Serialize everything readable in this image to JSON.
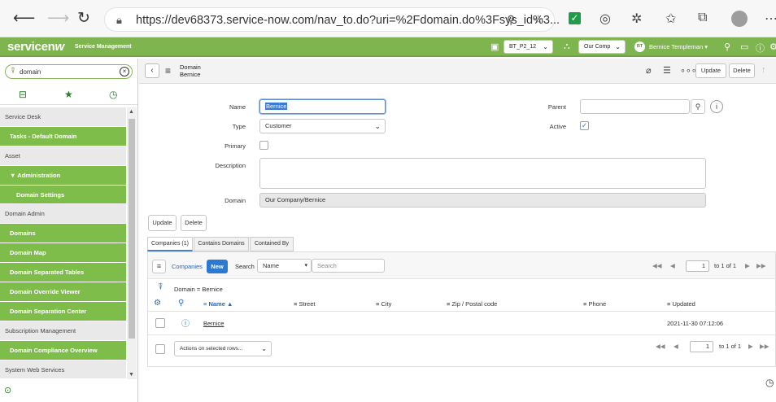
{
  "browser": {
    "url": "https://dev68373.service-now.com/nav_to.do?uri=%2Fdomain.do%3Fsys_id%3..."
  },
  "header": {
    "logo": "servicen",
    "logo_mark": "w",
    "product": "Service Management",
    "update_set": "BT_P2_12",
    "domain_picker": "Our Comp",
    "user_initials": "BT",
    "user_name": "Bernice Templeman"
  },
  "sidebar": {
    "filter_value": "domain",
    "items": [
      {
        "label": "Service Desk",
        "type": "section"
      },
      {
        "label": "Tasks - Default Domain",
        "type": "module"
      },
      {
        "label": "Asset",
        "type": "section"
      },
      {
        "label": "▼ Administration",
        "type": "module"
      },
      {
        "label": "Domain Settings",
        "type": "submodule"
      },
      {
        "label": "Domain Admin",
        "type": "section"
      },
      {
        "label": "Domains",
        "type": "module"
      },
      {
        "label": "Domain Map",
        "type": "module"
      },
      {
        "label": "Domain Separated Tables",
        "type": "module"
      },
      {
        "label": "Domain Override Viewer",
        "type": "module"
      },
      {
        "label": "Domain Separation Center",
        "type": "module"
      },
      {
        "label": "Subscription Management",
        "type": "section"
      },
      {
        "label": "Domain Compliance Overview",
        "type": "module"
      },
      {
        "label": "System Web Services",
        "type": "section"
      }
    ]
  },
  "form": {
    "table": "Domain",
    "record": "Bernice",
    "update_label": "Update",
    "delete_label": "Delete",
    "fields": {
      "name_label": "Name",
      "name_value": "Bernice",
      "type_label": "Type",
      "type_value": "Customer",
      "primary_label": "Primary",
      "description_label": "Description",
      "domain_label": "Domain",
      "domain_value": "Our Company/Bernice",
      "parent_label": "Parent",
      "active_label": "Active"
    }
  },
  "related": {
    "tabs": [
      "Companies (1)",
      "Contains Domains",
      "Contained By"
    ],
    "list_title": "Companies",
    "new_label": "New",
    "search_label": "Search",
    "search_field": "Name",
    "search_placeholder": "Search",
    "page_current": "1",
    "page_total_text": "to 1 of 1",
    "breadcrumb": "Domain = Bernice",
    "columns": [
      "Name ▲",
      "Street",
      "City",
      "Zip / Postal code",
      "Phone",
      "Updated"
    ],
    "row": {
      "name": "Bernice",
      "updated": "2021-11-30 07:12:06"
    },
    "actions_label": "Actions on selected rows..."
  }
}
